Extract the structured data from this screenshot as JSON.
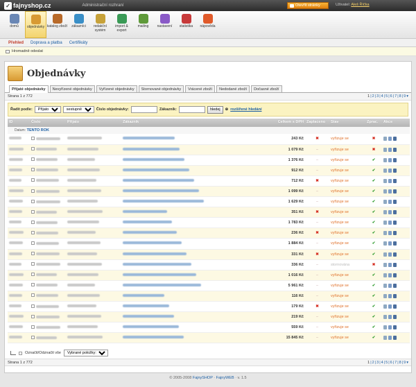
{
  "app": {
    "logo_text": "fajnyshop.cz",
    "admin_title": "Administrační rozhraní",
    "open_store_label": "Otevřít stránky",
    "user_label": "Uživatel:",
    "user_name": "Aleš Říčka"
  },
  "toolbar": [
    {
      "label": "domů",
      "color": "#6a87b5",
      "icon": "home-icon"
    },
    {
      "label": "objednávky",
      "color": "#d89a33",
      "icon": "orders-box-icon",
      "active": true
    },
    {
      "label": "katalog zboží",
      "color": "#b86a2a",
      "icon": "catalog-icon"
    },
    {
      "label": "zákazníci",
      "color": "#3a8fc7",
      "icon": "customers-icon"
    },
    {
      "label": "redakční systém",
      "color": "#c7a23a",
      "icon": "cms-icon"
    },
    {
      "label": "import & export",
      "color": "#3a9a56",
      "icon": "import-export-icon"
    },
    {
      "label": "mailing",
      "color": "#5f9a3a",
      "icon": "mailing-icon"
    },
    {
      "label": "nastavení",
      "color": "#8a5ac7",
      "icon": "settings-icon"
    },
    {
      "label": "statistika",
      "color": "#c73a3a",
      "icon": "stats-icon"
    },
    {
      "label": "nápověda",
      "color": "#e05a2a",
      "icon": "help-icon"
    }
  ],
  "subnav": [
    "Přehled",
    "Doprava a platba",
    "Certifikáty"
  ],
  "alert": "Hromadně odeslat",
  "page_title": "Objednávky",
  "tabs": [
    "Přijaté objednávky",
    "Nevyřízené objednávky",
    "Vyřízené objednávky",
    "Stornované objednávky",
    "Vrácené zboží",
    "Nedodané zboží",
    "Dočasné zboží"
  ],
  "pager": {
    "label": "Strana 1 z 772",
    "pages": [
      "1",
      "2",
      "3",
      "4",
      "5",
      "6",
      "7",
      "8",
      "9"
    ],
    "more_icon": "chevron-down-icon"
  },
  "filter": {
    "sort_label": "Řadit podle:",
    "sort_value": "Přijato",
    "order_value": "sestupně",
    "order_no_label": "Číslo objednávky:",
    "customer_label": "Zákazník:",
    "search_button": "hledej",
    "advanced_link": "rozšířené hledání"
  },
  "columns": {
    "id": "ID",
    "number": "Číslo",
    "received": "Přijato",
    "customer": "Zákazník",
    "total": "Celkem s DPH",
    "paid": "Zaplaceno",
    "status": "Stav",
    "processed": "Zprac.",
    "actions": "Akce"
  },
  "group": {
    "label": "Datum:",
    "value": "TENTO ROK"
  },
  "rows": [
    {
      "total": "243 Kč",
      "paid": "x",
      "status": "vyřizuje se",
      "processed": "no"
    },
    {
      "total": "1 079 Kč",
      "paid": "-",
      "status": "vyřizuje se",
      "processed": "no"
    },
    {
      "total": "1 376 Kč",
      "paid": "-",
      "status": "vyřizuje se",
      "processed": "ok"
    },
    {
      "total": "912 Kč",
      "paid": "-",
      "status": "vyřizuje se",
      "processed": "ok"
    },
    {
      "total": "712 Kč",
      "paid": "x",
      "status": "vyřizuje se",
      "processed": "ok"
    },
    {
      "total": "1 099 Kč",
      "paid": "-",
      "status": "vyřizuje se",
      "processed": "ok"
    },
    {
      "total": "1 629 Kč",
      "paid": "-",
      "status": "vyřizuje se",
      "processed": "ok"
    },
    {
      "total": "351 Kč",
      "paid": "x",
      "status": "vyřizuje se",
      "processed": "ok"
    },
    {
      "total": "1 783 Kč",
      "paid": "-",
      "status": "vyřizuje se",
      "processed": "ok"
    },
    {
      "total": "236 Kč",
      "paid": "x",
      "status": "vyřizuje se",
      "processed": "ok"
    },
    {
      "total": "1 884 Kč",
      "paid": "-",
      "status": "vyřizuje se",
      "processed": "ok"
    },
    {
      "total": "331 Kč",
      "paid": "x",
      "status": "vyřizuje se",
      "processed": "ok"
    },
    {
      "total": "336 Kč",
      "paid": "-",
      "status": "stornována",
      "processed": "no"
    },
    {
      "total": "1 016 Kč",
      "paid": "-",
      "status": "vyřizuje se",
      "processed": "ok"
    },
    {
      "total": "5 961 Kč",
      "paid": "-",
      "status": "vyřizuje se",
      "processed": "ok"
    },
    {
      "total": "116 Kč",
      "paid": "-",
      "status": "vyřizuje se",
      "processed": "ok"
    },
    {
      "total": "179 Kč",
      "paid": "x",
      "status": "vyřizuje se",
      "processed": "ok"
    },
    {
      "total": "219 Kč",
      "paid": "-",
      "status": "vyřizuje se",
      "processed": "ok"
    },
    {
      "total": "559 Kč",
      "paid": "-",
      "status": "vyřizuje se",
      "processed": "ok"
    },
    {
      "total": "15 845 Kč",
      "paid": "-",
      "status": "vyřizuje se",
      "processed": "ok"
    }
  ],
  "bulk": {
    "select_all_label": "Označit/Odznačit vše",
    "selected_items": "Vybrané položky:"
  },
  "footer": {
    "copyright": "© 2005-2008",
    "link1": "FajnySHOP",
    "sep": "·",
    "link2": "FajnyWEB",
    "version": "· v. 1.5"
  }
}
